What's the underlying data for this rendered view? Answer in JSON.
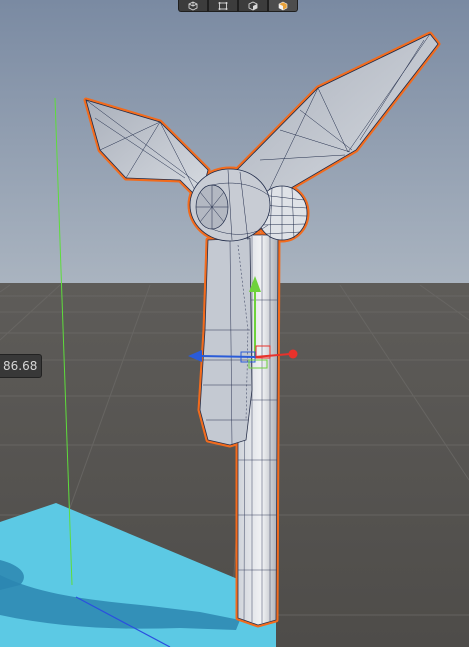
{
  "viewport": {
    "sky_top": "#7f8ea6",
    "sky_horizon": "#a8b2bf",
    "ground": "#555350",
    "grid_line": "#6a6864",
    "selection_outline": "#f26b1d",
    "plane_color": "#5cc8e4"
  },
  "toolbar": {
    "buttons": [
      {
        "icon": "cube-wireframe-icon",
        "active": false
      },
      {
        "icon": "rect-transform-icon",
        "active": false
      },
      {
        "icon": "cube-shaded-icon",
        "active": false
      },
      {
        "icon": "cube-half-icon",
        "active": true
      }
    ]
  },
  "gizmo": {
    "x_color": "#e8322b",
    "y_color": "#6ed23c",
    "z_color": "#2a5bd8"
  },
  "value_tag": {
    "text": "86.68"
  }
}
